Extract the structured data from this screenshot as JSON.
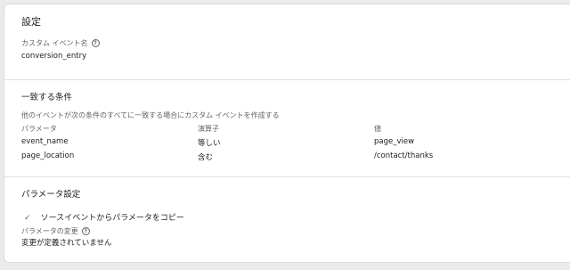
{
  "settings": {
    "title": "設定"
  },
  "custom_event": {
    "label": "カスタム イベント名",
    "value": "conversion_entry"
  },
  "conditions": {
    "title": "一致する条件",
    "description": "他のイベントが次の条件のすべてに一致する場合にカスタム イベントを作成する",
    "headers": {
      "param": "パラメータ",
      "operator": "演算子",
      "value": "値"
    },
    "rows": [
      {
        "param": "event_name",
        "operator": "等しい",
        "value": "page_view"
      },
      {
        "param": "page_location",
        "operator": "含む",
        "value": "/contact/thanks"
      }
    ]
  },
  "param_settings": {
    "title": "パラメータ設定",
    "copy_label": "ソースイベントからパラメータをコピー",
    "changes_label": "パラメータの変更",
    "changes_value": "変更が定義されていません"
  },
  "icons": {
    "help": "help-circle-icon",
    "check": "check-icon"
  },
  "colors": {
    "background": "#ebebeb",
    "card": "#ffffff",
    "divider": "#e0e0e0",
    "secondary_text": "#5f6368"
  }
}
